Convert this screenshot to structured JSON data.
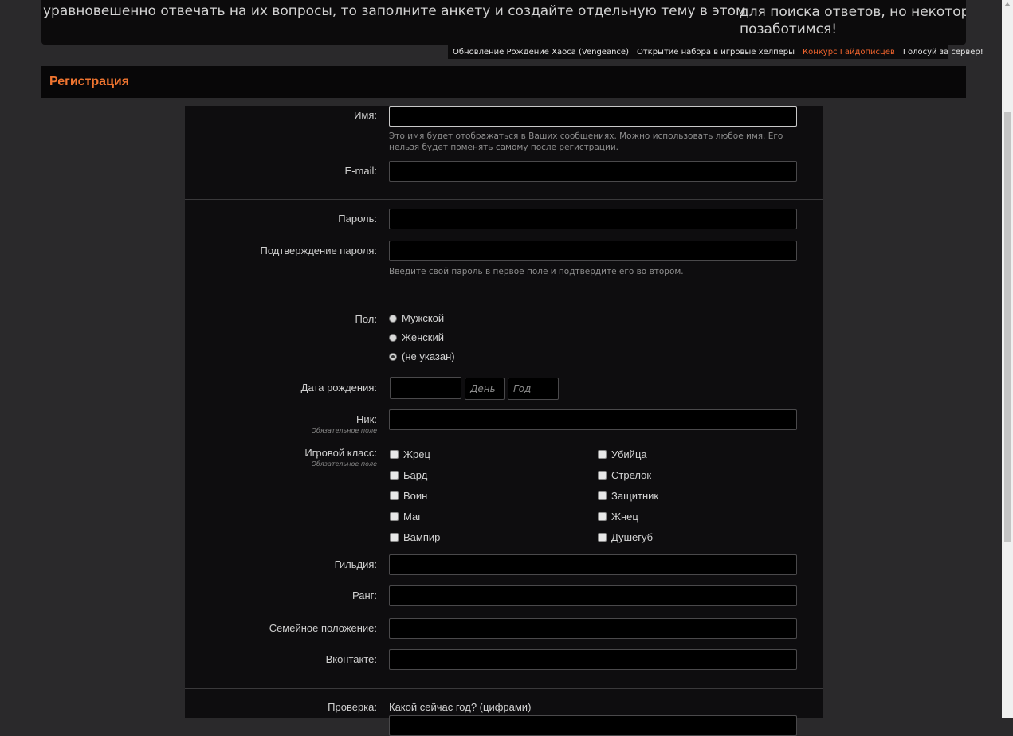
{
  "banner": {
    "left_text": "уравновешенно отвечать на их вопросы, то заполните анкету и создайте отдельную тему в этом",
    "right_line1": "для поиска ответов, но некоторы",
    "right_line2": "позаботимся!"
  },
  "notices": [
    {
      "label": "Обновление Рождение Хаоса (Vengeance)",
      "highlight": false
    },
    {
      "label": "Открытие набора в игровые хелперы",
      "highlight": false
    },
    {
      "label": "Конкурс Гайдописцев",
      "highlight": true
    },
    {
      "label": "Голосуй за сервер!",
      "highlight": false
    }
  ],
  "page_title": "Регистрация",
  "form": {
    "name_label": "Имя:",
    "name_hint": "Это имя будет отображаться в Ваших сообщениях. Можно использовать любое имя. Его нельзя будет поменять самому после регистрации.",
    "email_label": "E-mail:",
    "password_label": "Пароль:",
    "password_confirm_label": "Подтверждение пароля:",
    "password_hint": "Введите свой пароль в первое поле и подтвердите его во втором.",
    "gender_label": "Пол:",
    "gender_options": [
      "Мужской",
      "Женский",
      "(не указан)"
    ],
    "gender_selected": "(не указан)",
    "birth_label": "Дата рождения:",
    "day_placeholder": "День",
    "year_placeholder": "Год",
    "nick_label": "Ник:",
    "required_note": "Обязательное поле",
    "class_label": "Игровой класс:",
    "classes_col1": [
      "Жрец",
      "Бард",
      "Воин",
      "Маг",
      "Вампир"
    ],
    "classes_col2": [
      "Убийца",
      "Стрелок",
      "Защитник",
      "Жнец",
      "Душегуб"
    ],
    "guild_label": "Гильдия:",
    "rank_label": "Ранг:",
    "family_label": "Семейное положение:",
    "vk_label": "Вконтакте:",
    "check_label": "Проверка:",
    "check_question": "Какой сейчас год? (цифрами)"
  },
  "colors": {
    "accent": "#f07530",
    "background": "#2a292b",
    "panel": "#0e0d0f"
  }
}
